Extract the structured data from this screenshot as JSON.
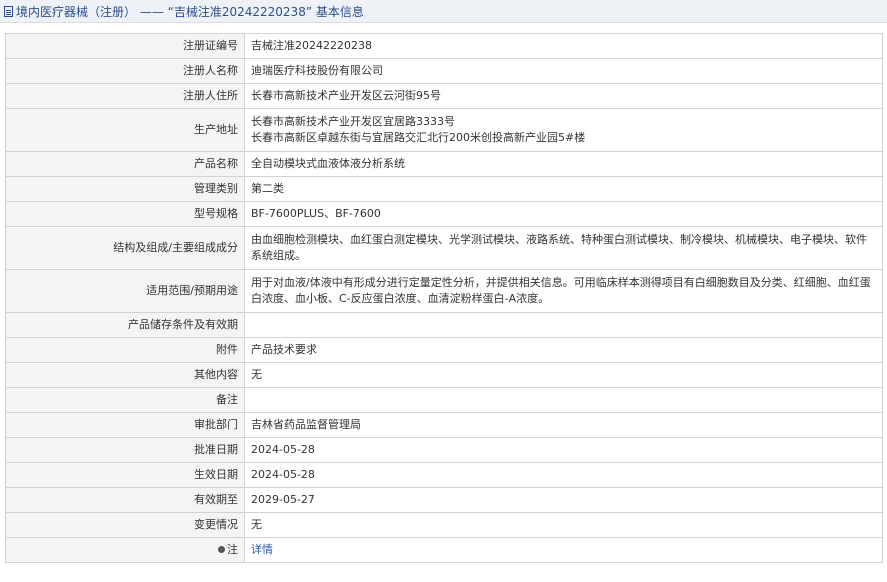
{
  "header": {
    "text": "境内医疗器械（注册） —— “吉械注准20242220238” 基本信息"
  },
  "rows": [
    {
      "label": "注册证编号",
      "value": "吉械注准20242220238"
    },
    {
      "label": "注册人名称",
      "value": "迪瑞医疗科技股份有限公司"
    },
    {
      "label": "注册人住所",
      "value": "长春市高新技术产业开发区云河街95号"
    },
    {
      "label": "生产地址",
      "value": "长春市高新技术产业开发区宜居路3333号\n长春市高新区卓越东街与宜居路交汇北行200米创投高新产业园5#楼"
    },
    {
      "label": "产品名称",
      "value": "全自动模块式血液体液分析系统"
    },
    {
      "label": "管理类别",
      "value": "第二类"
    },
    {
      "label": "型号规格",
      "value": "BF-7600PLUS、BF-7600"
    },
    {
      "label": "结构及组成/主要组成成分",
      "value": "由血细胞检测模块、血红蛋白测定模块、光学测试模块、液路系统、特种蛋白测试模块、制冷模块、机械模块、电子模块、软件系统组成。"
    },
    {
      "label": "适用范围/预期用途",
      "value": "用于对血液/体液中有形成分进行定量定性分析，并提供相关信息。可用临床样本测得项目有白细胞数目及分类、红细胞、血红蛋白浓度、血小板、C-反应蛋白浓度、血清淀粉样蛋白-A浓度。"
    },
    {
      "label": "产品储存条件及有效期",
      "value": ""
    },
    {
      "label": "附件",
      "value": "产品技术要求"
    },
    {
      "label": "其他内容",
      "value": "无"
    },
    {
      "label": "备注",
      "value": ""
    },
    {
      "label": "审批部门",
      "value": "吉林省药品监督管理局"
    },
    {
      "label": "批准日期",
      "value": "2024-05-28"
    },
    {
      "label": "生效日期",
      "value": "2024-05-28"
    },
    {
      "label": "有效期至",
      "value": "2029-05-27"
    },
    {
      "label": "变更情况",
      "value": "无"
    }
  ],
  "note": {
    "label": "注",
    "link_text": "详情"
  }
}
